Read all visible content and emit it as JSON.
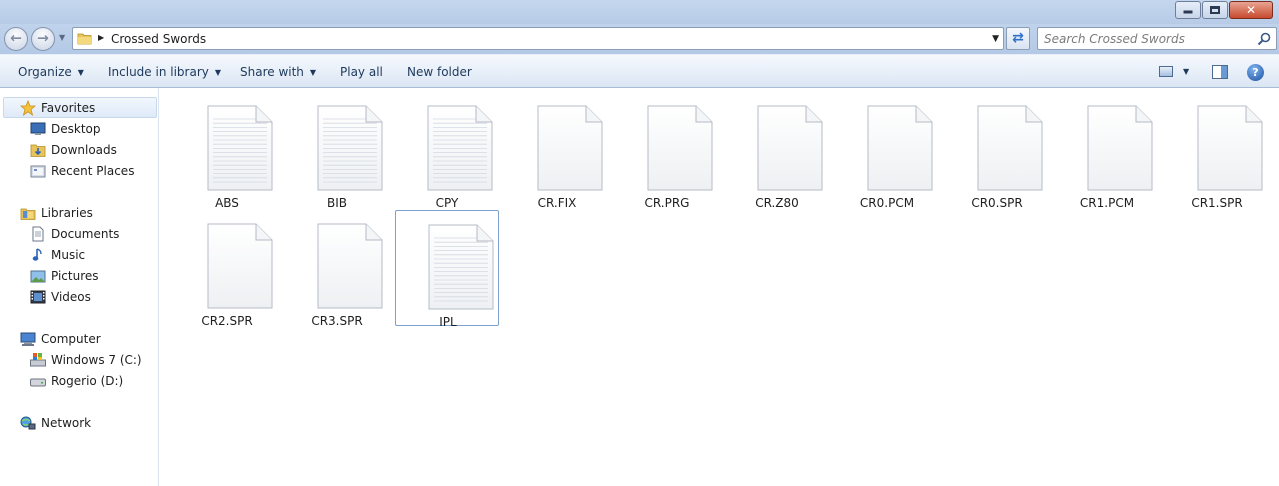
{
  "window": {
    "min_glyph": "",
    "max_glyph": "",
    "close_glyph": "✕"
  },
  "address": {
    "path": "Crossed Swords"
  },
  "search": {
    "placeholder": "Search Crossed Swords"
  },
  "commands": [
    {
      "label": "Organize",
      "has_menu": true
    },
    {
      "label": "Include in library",
      "has_menu": true
    },
    {
      "label": "Share with",
      "has_menu": true
    },
    {
      "label": "Play all",
      "has_menu": false
    },
    {
      "label": "New folder",
      "has_menu": false
    }
  ],
  "help_glyph": "?",
  "nav": {
    "favorites": {
      "label": "Favorites",
      "icon": "star-icon"
    },
    "favorites_items": [
      {
        "label": "Desktop",
        "icon": "desktop-icon"
      },
      {
        "label": "Downloads",
        "icon": "downloads-folder-icon"
      },
      {
        "label": "Recent Places",
        "icon": "recent-places-icon"
      }
    ],
    "libraries": {
      "label": "Libraries",
      "icon": "libraries-icon"
    },
    "libraries_items": [
      {
        "label": "Documents",
        "icon": "documents-icon"
      },
      {
        "label": "Music",
        "icon": "music-icon"
      },
      {
        "label": "Pictures",
        "icon": "pictures-icon"
      },
      {
        "label": "Videos",
        "icon": "videos-icon"
      }
    ],
    "computer": {
      "label": "Computer",
      "icon": "computer-icon"
    },
    "computer_items": [
      {
        "label": "Windows 7 (C:)",
        "icon": "windows-drive-icon"
      },
      {
        "label": "Rogerio (D:)",
        "icon": "drive-icon"
      }
    ],
    "network": {
      "label": "Network",
      "icon": "network-icon"
    }
  },
  "files": [
    {
      "name": "ABS",
      "type": "text"
    },
    {
      "name": "BIB",
      "type": "text"
    },
    {
      "name": "CPY",
      "type": "text"
    },
    {
      "name": "CR.FIX",
      "type": "blank"
    },
    {
      "name": "CR.PRG",
      "type": "blank"
    },
    {
      "name": "CR.Z80",
      "type": "blank"
    },
    {
      "name": "CR0.PCM",
      "type": "blank"
    },
    {
      "name": "CR0.SPR",
      "type": "blank"
    },
    {
      "name": "CR1.PCM",
      "type": "blank"
    },
    {
      "name": "CR1.SPR",
      "type": "blank"
    },
    {
      "name": "CR2.SPR",
      "type": "blank"
    },
    {
      "name": "CR3.SPR",
      "type": "blank"
    },
    {
      "name": "IPL",
      "type": "text",
      "selected": true
    }
  ]
}
